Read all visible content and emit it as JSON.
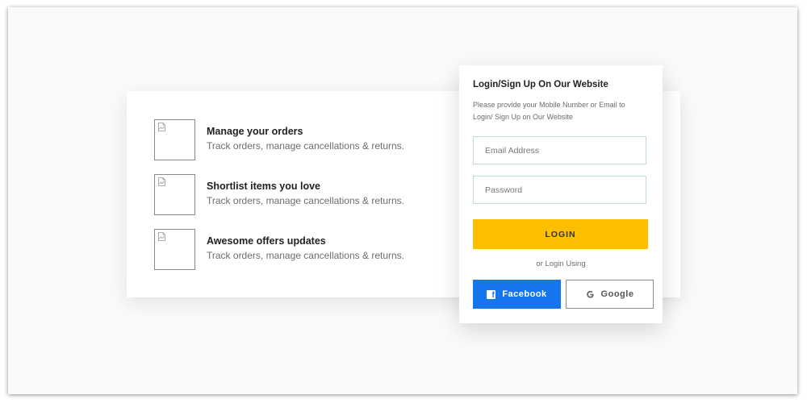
{
  "features": [
    {
      "title": "Manage your orders",
      "desc": "Track orders, manage cancellations & returns."
    },
    {
      "title": "Shortlist items you love",
      "desc": "Track orders, manage cancellations & returns."
    },
    {
      "title": "Awesome offers updates",
      "desc": "Track orders, manage cancellations & returns."
    }
  ],
  "login": {
    "title": "Login/Sign Up On Our Website",
    "description": "Please provide your Mobile Number or Email to Login/ Sign Up on Our Website",
    "email_placeholder": "Email Address",
    "password_placeholder": "Password",
    "login_label": "LOGIN",
    "or_text": "or Login Using",
    "facebook_label": "Facebook",
    "google_label": "Google"
  },
  "icons": {
    "thumbnail": "broken-image-icon",
    "facebook": "facebook-icon",
    "google": "google-icon"
  },
  "colors": {
    "accent": "#fdbf00",
    "facebook": "#1475ec",
    "field_border": "#bfdbe0"
  }
}
